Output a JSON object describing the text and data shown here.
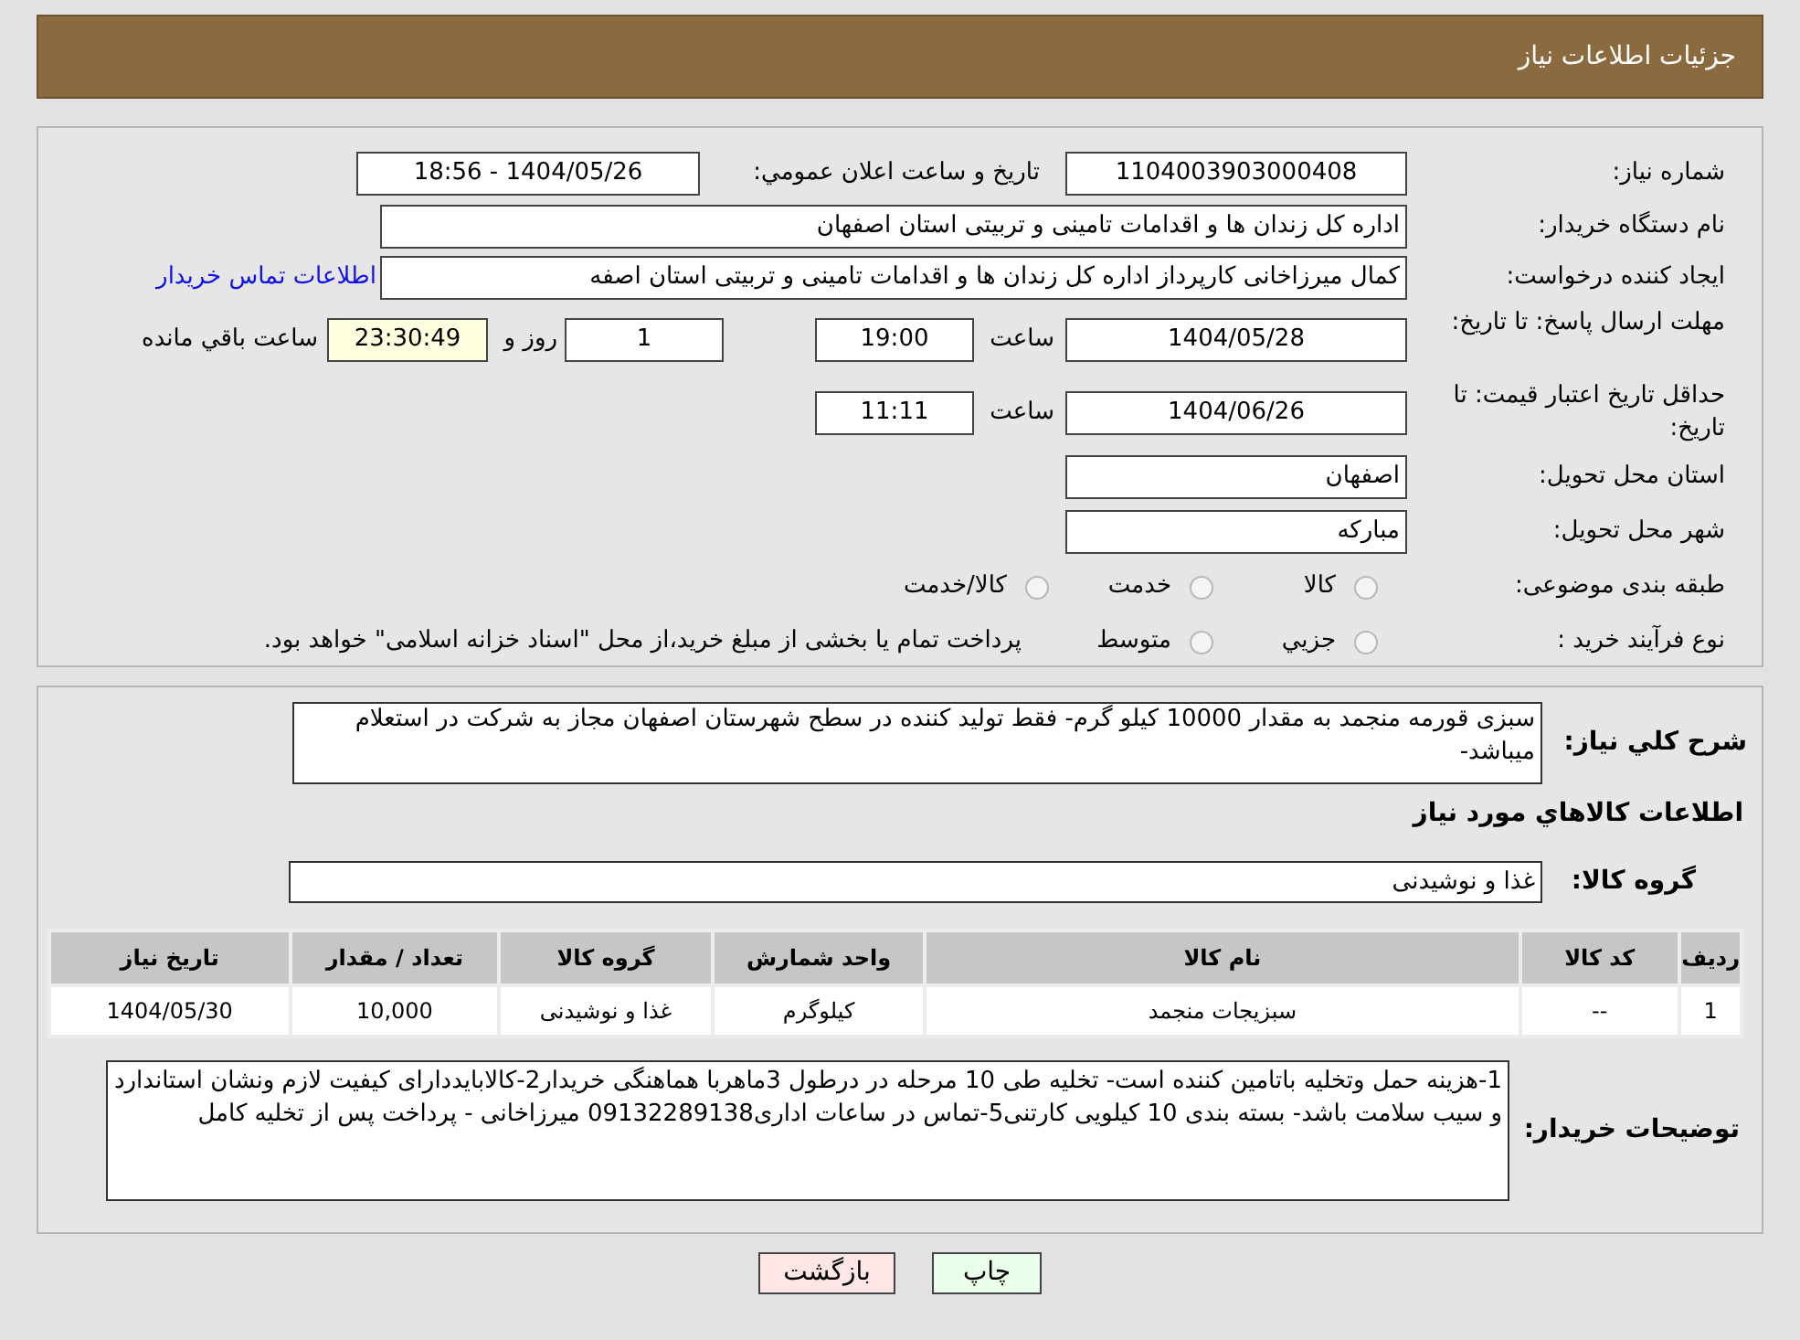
{
  "header": {
    "title": "جزئیات اطلاعات نیاز"
  },
  "fields": {
    "need_number": {
      "label": "شماره نیاز:",
      "value": "1104003903000408"
    },
    "announce": {
      "label": "تاریخ و ساعت اعلان عمومي:",
      "value": "1404/05/26 - 18:56"
    },
    "buyer": {
      "label": "نام دستگاه خريدار:",
      "value": "اداره کل زندان ها و اقدامات تامینی و تربیتی استان اصفهان"
    },
    "creator": {
      "label": "ایجاد کننده درخواست:",
      "value": "کمال میرزاخانی کارپرداز اداره کل زندان ها و اقدامات تامینی و تربیتی استان اصفه",
      "link": "اطلاعات تماس خریدار"
    },
    "deadline": {
      "label": "مهلت ارسال پاسخ: تا تاریخ:",
      "date": "1404/05/28",
      "time_label": "ساعت",
      "time": "19:00",
      "days": "1",
      "days_label": "روز و",
      "remaining": "23:30:49",
      "remaining_label": "ساعت باقي مانده"
    },
    "validity": {
      "label": "حداقل تاریخ اعتبار قیمت: تا تاریخ:",
      "date": "1404/06/26",
      "time_label": "ساعت",
      "time": "11:11"
    },
    "province": {
      "label": "استان محل تحویل:",
      "value": "اصفهان"
    },
    "city": {
      "label": "شهر محل تحویل:",
      "value": "مبارکه"
    }
  },
  "category": {
    "label": "طبقه بندی موضوعی:",
    "options": [
      {
        "label": "کالا",
        "selected": false
      },
      {
        "label": "خدمت",
        "selected": false
      },
      {
        "label": "کالا/خدمت",
        "selected": false
      }
    ]
  },
  "process": {
    "label": "نوع فرآیند خرید :",
    "options": [
      {
        "label": "جزيي",
        "selected": false
      },
      {
        "label": "متوسط",
        "selected": false
      }
    ],
    "note": "پرداخت تمام یا بخشی از مبلغ خرید،از محل \"اسناد خزانه اسلامی\" خواهد بود."
  },
  "description": {
    "label": "شرح کلي نياز:",
    "value": "سبزی قورمه منجمد به مقدار 10000 کیلو گرم- فقط تولید کننده در سطح شهرستان اصفهان مجاز به شرکت در استعلام میباشد-"
  },
  "goods_heading": "اطلاعات کالاهاي مورد نياز",
  "goods_group": {
    "label": "گروه کالا:",
    "value": "غذا و نوشیدنی"
  },
  "table": {
    "columns": [
      "ردیف",
      "کد کالا",
      "نام کالا",
      "واحد شمارش",
      "گروه کالا",
      "تعداد / مقدار",
      "تاریخ نیاز"
    ],
    "rows": [
      [
        "1",
        "--",
        "سبزیجات منجمد",
        "کیلوگرم",
        "غذا و نوشیدنی",
        "10,000",
        "1404/05/30"
      ]
    ]
  },
  "notes": {
    "label": "توضیحات خریدار:",
    "value": "1-هزینه حمل وتخلیه باتامین کننده است- تخلیه طی 10 مرحله در درطول 3ماهربا هماهنگی خریدار2-کالابایددارای کیفیت لازم ونشان استاندارد و سیب سلامت باشد- بسته بندی 10 کیلویی کارتنی5-تماس در ساعات اداری09132289138 میرزاخانی  - پرداخت پس از تخلیه کامل"
  },
  "buttons": [
    {
      "label": "چاپ",
      "kind": "print"
    },
    {
      "label": "بازگشت",
      "kind": "back"
    }
  ]
}
